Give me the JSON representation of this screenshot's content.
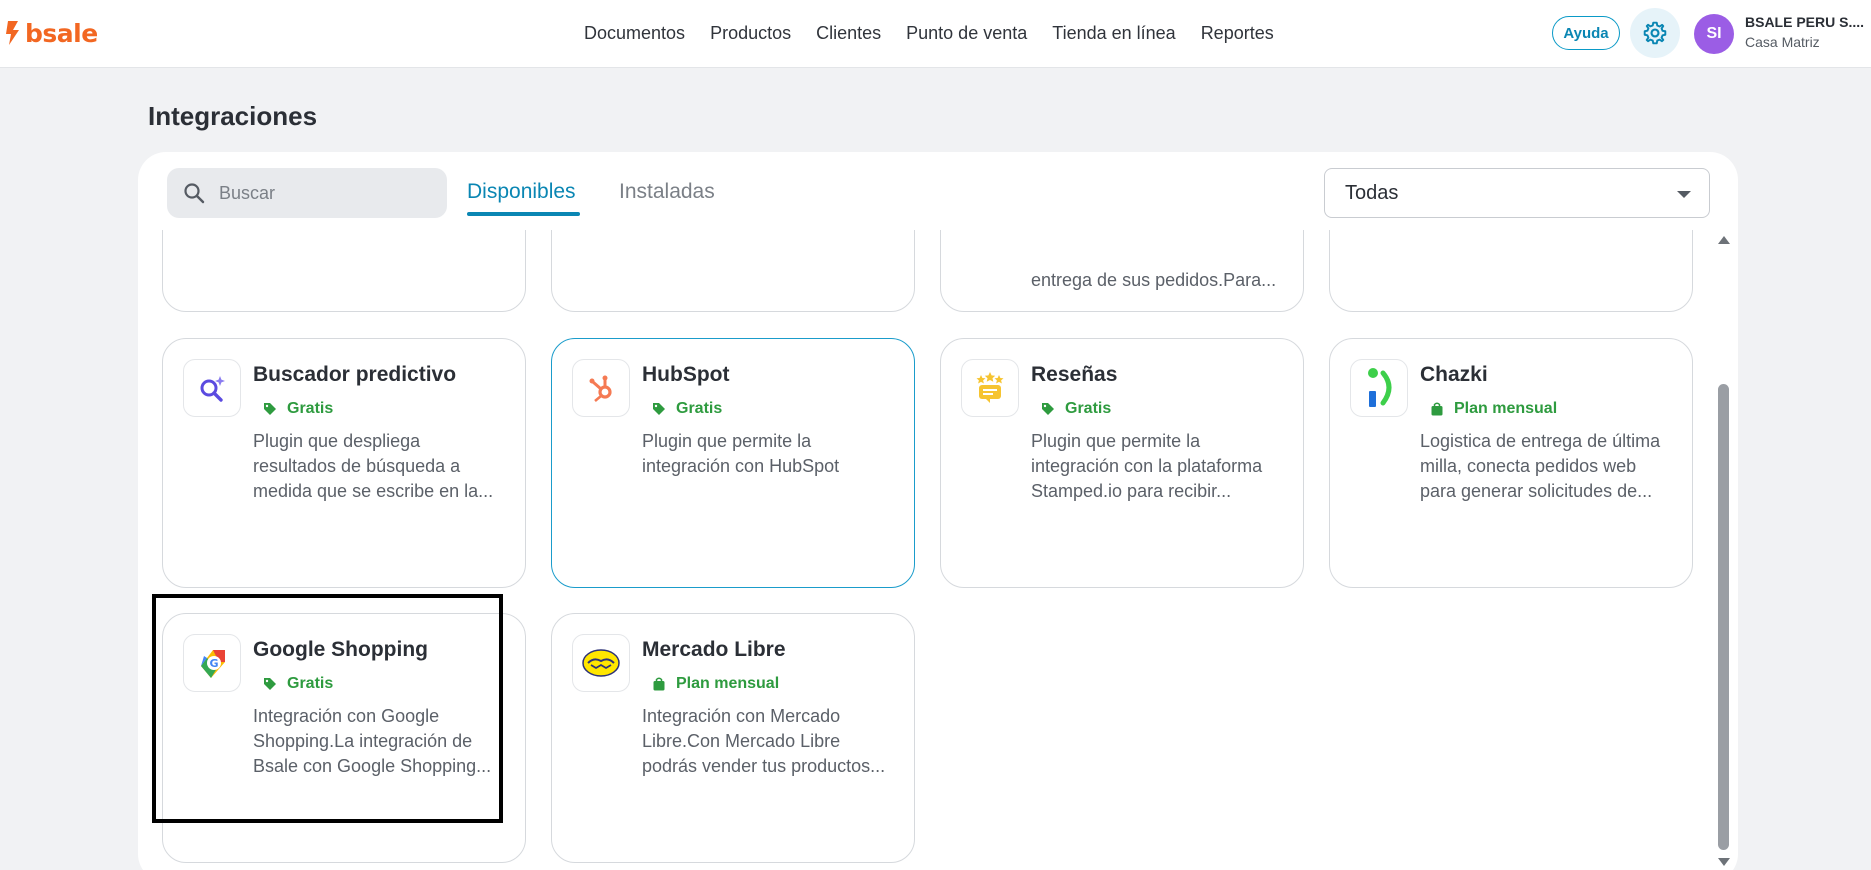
{
  "header": {
    "logo_text": "bsale",
    "nav": [
      "Documentos",
      "Productos",
      "Clientes",
      "Punto de venta",
      "Tienda en línea",
      "Reportes"
    ],
    "help_label": "Ayuda",
    "avatar_initials": "SI",
    "company_name": "BSALE PERU S....",
    "company_branch": "Casa Matriz",
    "accent": "#0a86b3",
    "brand": "#f26722"
  },
  "page": {
    "title": "Integraciones"
  },
  "toolbar": {
    "search_placeholder": "Buscar",
    "tabs": [
      {
        "label": "Disponibles",
        "active": true
      },
      {
        "label": "Instaladas",
        "active": false
      }
    ],
    "filter_value": "Todas"
  },
  "partial_row": {
    "desc_third": "entrega de sus pedidos.Para..."
  },
  "cards": [
    {
      "title": "Buscador predictivo",
      "badge": "Gratis",
      "badge_icon": "tag-icon",
      "icon": "search-sparkle-icon",
      "desc": "Plugin que despliega resultados de búsqueda a medida que se escribe en la..."
    },
    {
      "title": "HubSpot",
      "badge": "Gratis",
      "badge_icon": "tag-icon",
      "icon": "hubspot-icon",
      "desc": "Plugin que permite la integración con HubSpot"
    },
    {
      "title": "Reseñas",
      "badge": "Gratis",
      "badge_icon": "tag-icon",
      "icon": "reviews-stars-icon",
      "desc": "Plugin que permite la integración con la plataforma Stamped.io para recibir..."
    },
    {
      "title": "Chazki",
      "badge": "Plan mensual",
      "badge_icon": "bag-icon",
      "icon": "chazki-icon",
      "desc": "Logistica de entrega de última milla, conecta pedidos web para generar solicitudes de..."
    },
    {
      "title": "Google Shopping",
      "badge": "Gratis",
      "badge_icon": "tag-icon",
      "icon": "google-shopping-icon",
      "desc": "Integración con Google Shopping.La integración de Bsale con Google Shopping..."
    },
    {
      "title": "Mercado Libre",
      "badge": "Plan mensual",
      "badge_icon": "bag-icon",
      "icon": "mercado-libre-icon",
      "desc": "Integración con Mercado Libre.Con Mercado Libre podrás vender tus productos..."
    }
  ]
}
